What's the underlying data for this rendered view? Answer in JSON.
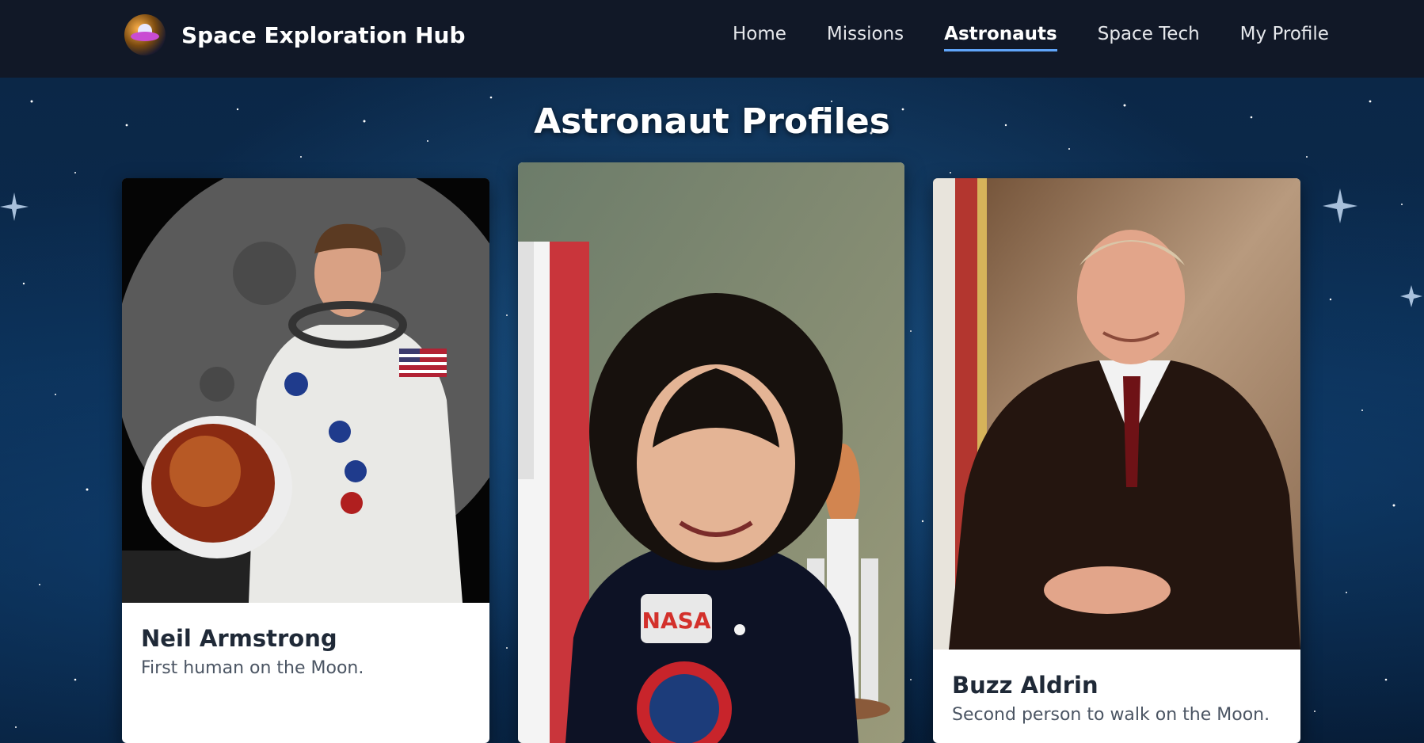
{
  "brand": {
    "title": "Space Exploration Hub",
    "logo_icon": "ufo-astronaut-logo"
  },
  "nav": {
    "items": [
      {
        "label": "Home",
        "active": false
      },
      {
        "label": "Missions",
        "active": false
      },
      {
        "label": "Astronauts",
        "active": true
      },
      {
        "label": "Space Tech",
        "active": false
      },
      {
        "label": "My Profile",
        "active": false
      }
    ]
  },
  "main": {
    "title": "Astronaut Profiles",
    "cards": [
      {
        "name": "Neil Armstrong",
        "description": "First human on the Moon.",
        "photo_icon": "astronaut-spacesuit-portrait"
      },
      {
        "name": "",
        "description": "",
        "photo_icon": "astronaut-flight-suit-portrait"
      },
      {
        "name": "Buzz Aldrin",
        "description": "Second person to walk on the Moon.",
        "photo_icon": "astronaut-business-suit-portrait"
      }
    ]
  },
  "colors": {
    "navbar": "#111827",
    "active_underline": "#60a5fa",
    "card_bg": "#ffffff",
    "name_text": "#1f2937",
    "desc_text": "#4b5563"
  }
}
